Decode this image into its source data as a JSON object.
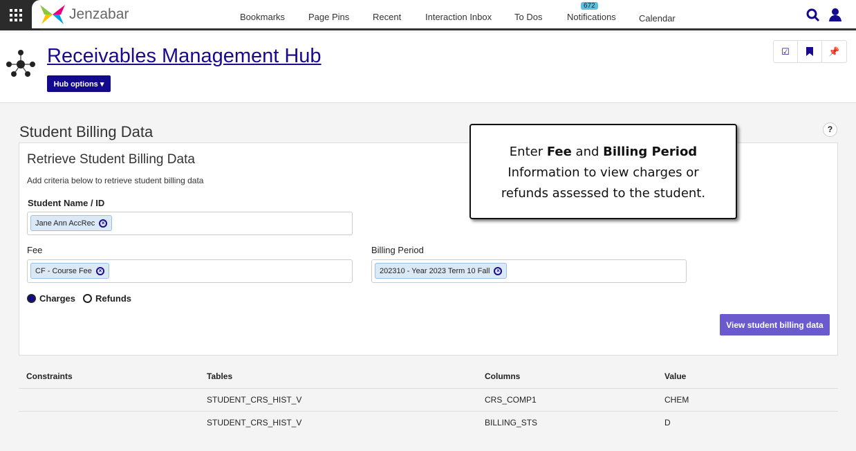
{
  "topbar": {
    "brand": "Jenzabar",
    "nav": [
      "Bookmarks",
      "Page Pins",
      "Recent",
      "Interaction Inbox",
      "To Dos",
      "Notifications",
      "Calendar"
    ],
    "notifications_count": "672"
  },
  "header": {
    "title": "Receivables Management Hub",
    "hub_options": "Hub options"
  },
  "page": {
    "section_title": "Student Billing Data",
    "help": "?"
  },
  "form": {
    "title": "Retrieve Student Billing Data",
    "description": "Add criteria below to retrieve student billing data",
    "student_label": "Student Name / ID",
    "student_value": "Jane Ann AccRec",
    "fee_label": "Fee",
    "fee_value": "CF - Course Fee",
    "period_label": "Billing Period",
    "period_value": "202310 - Year 2023 Term 10 Fall",
    "radio_charges": "Charges",
    "radio_refunds": "Refunds",
    "selected": "Charges",
    "submit": "View student billing data"
  },
  "table": {
    "headers": [
      "Constraints",
      "Tables",
      "Columns",
      "Value"
    ],
    "rows": [
      [
        "",
        "STUDENT_CRS_HIST_V",
        "CRS_COMP1",
        "CHEM"
      ],
      [
        "",
        "STUDENT_CRS_HIST_V",
        "BILLING_STS",
        "D"
      ]
    ]
  },
  "callout": {
    "pre": "Enter ",
    "b1": "Fee",
    "mid": " and ",
    "b2": "Billing Period",
    "rest": "Information to view charges or refunds assessed to the student."
  }
}
